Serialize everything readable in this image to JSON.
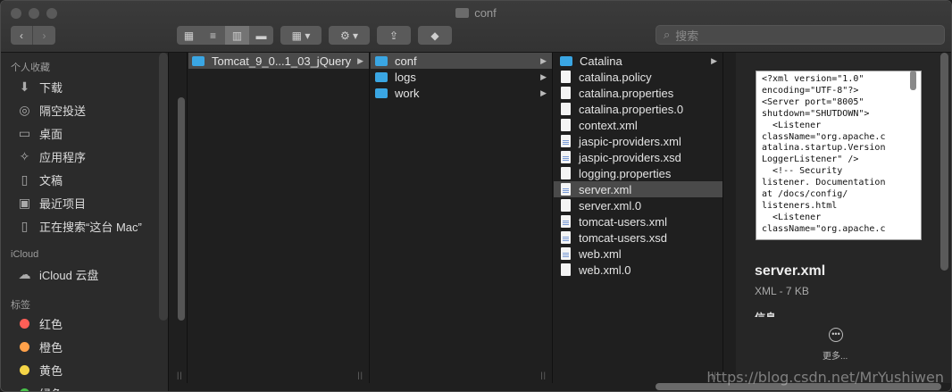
{
  "window": {
    "title": "conf"
  },
  "toolbar": {
    "back_icon": "chevron-left",
    "forward_icon": "chevron-right",
    "search_placeholder": "搜索"
  },
  "sidebar": {
    "favorites_header": "个人收藏",
    "favorites": [
      {
        "label": "下载",
        "icon": "download-icon"
      },
      {
        "label": "隔空投送",
        "icon": "airdrop-icon"
      },
      {
        "label": "桌面",
        "icon": "desktop-icon"
      },
      {
        "label": "应用程序",
        "icon": "applications-icon"
      },
      {
        "label": "文稿",
        "icon": "documents-icon"
      },
      {
        "label": "最近项目",
        "icon": "recents-icon"
      },
      {
        "label": "正在搜索“这台 Mac”",
        "icon": "search-folder-icon"
      }
    ],
    "icloud_header": "iCloud",
    "icloud": [
      {
        "label": "iCloud 云盘",
        "icon": "cloud-icon"
      }
    ],
    "tags_header": "标签",
    "tags": [
      {
        "label": "红色",
        "color": "#ff5f57"
      },
      {
        "label": "橙色",
        "color": "#ffa14a"
      },
      {
        "label": "黄色",
        "color": "#f5d547"
      },
      {
        "label": "绿色",
        "color": "#48c24a"
      }
    ]
  },
  "columns": {
    "col1": [
      {
        "label": "Tomcat_9_0...1_03_jQuery",
        "type": "folder",
        "selected": true,
        "has_children": true
      }
    ],
    "col2": [
      {
        "label": "conf",
        "type": "folder",
        "selected": true,
        "has_children": true
      },
      {
        "label": "logs",
        "type": "folder",
        "has_children": true
      },
      {
        "label": "work",
        "type": "folder",
        "has_children": true
      }
    ],
    "col3": [
      {
        "label": "Catalina",
        "type": "folder",
        "has_children": true
      },
      {
        "label": "catalina.policy",
        "type": "file"
      },
      {
        "label": "catalina.properties",
        "type": "file"
      },
      {
        "label": "catalina.properties.0",
        "type": "file"
      },
      {
        "label": "context.xml",
        "type": "file"
      },
      {
        "label": "jaspic-providers.xml",
        "type": "xml"
      },
      {
        "label": "jaspic-providers.xsd",
        "type": "xml"
      },
      {
        "label": "logging.properties",
        "type": "file"
      },
      {
        "label": "server.xml",
        "type": "xml",
        "selected": true
      },
      {
        "label": "server.xml.0",
        "type": "file"
      },
      {
        "label": "tomcat-users.xml",
        "type": "xml"
      },
      {
        "label": "tomcat-users.xsd",
        "type": "xml"
      },
      {
        "label": "web.xml",
        "type": "xml"
      },
      {
        "label": "web.xml.0",
        "type": "file"
      }
    ]
  },
  "preview": {
    "code": "<?xml version=\"1.0\"\nencoding=\"UTF-8\"?>\n<Server port=\"8005\"\nshutdown=\"SHUTDOWN\">\n  <Listener\nclassName=\"org.apache.c\natalina.startup.Version\nLoggerListener\" />\n  <!-- Security\nlistener. Documentation\nat /docs/config/\nlisteners.html\n  <Listener\nclassName=\"org.apache.c",
    "name": "server.xml",
    "meta": "XML - 7 KB",
    "info_label": "信息",
    "more_label": "更多..."
  },
  "watermark": "https://blog.csdn.net/MrYushiwen"
}
